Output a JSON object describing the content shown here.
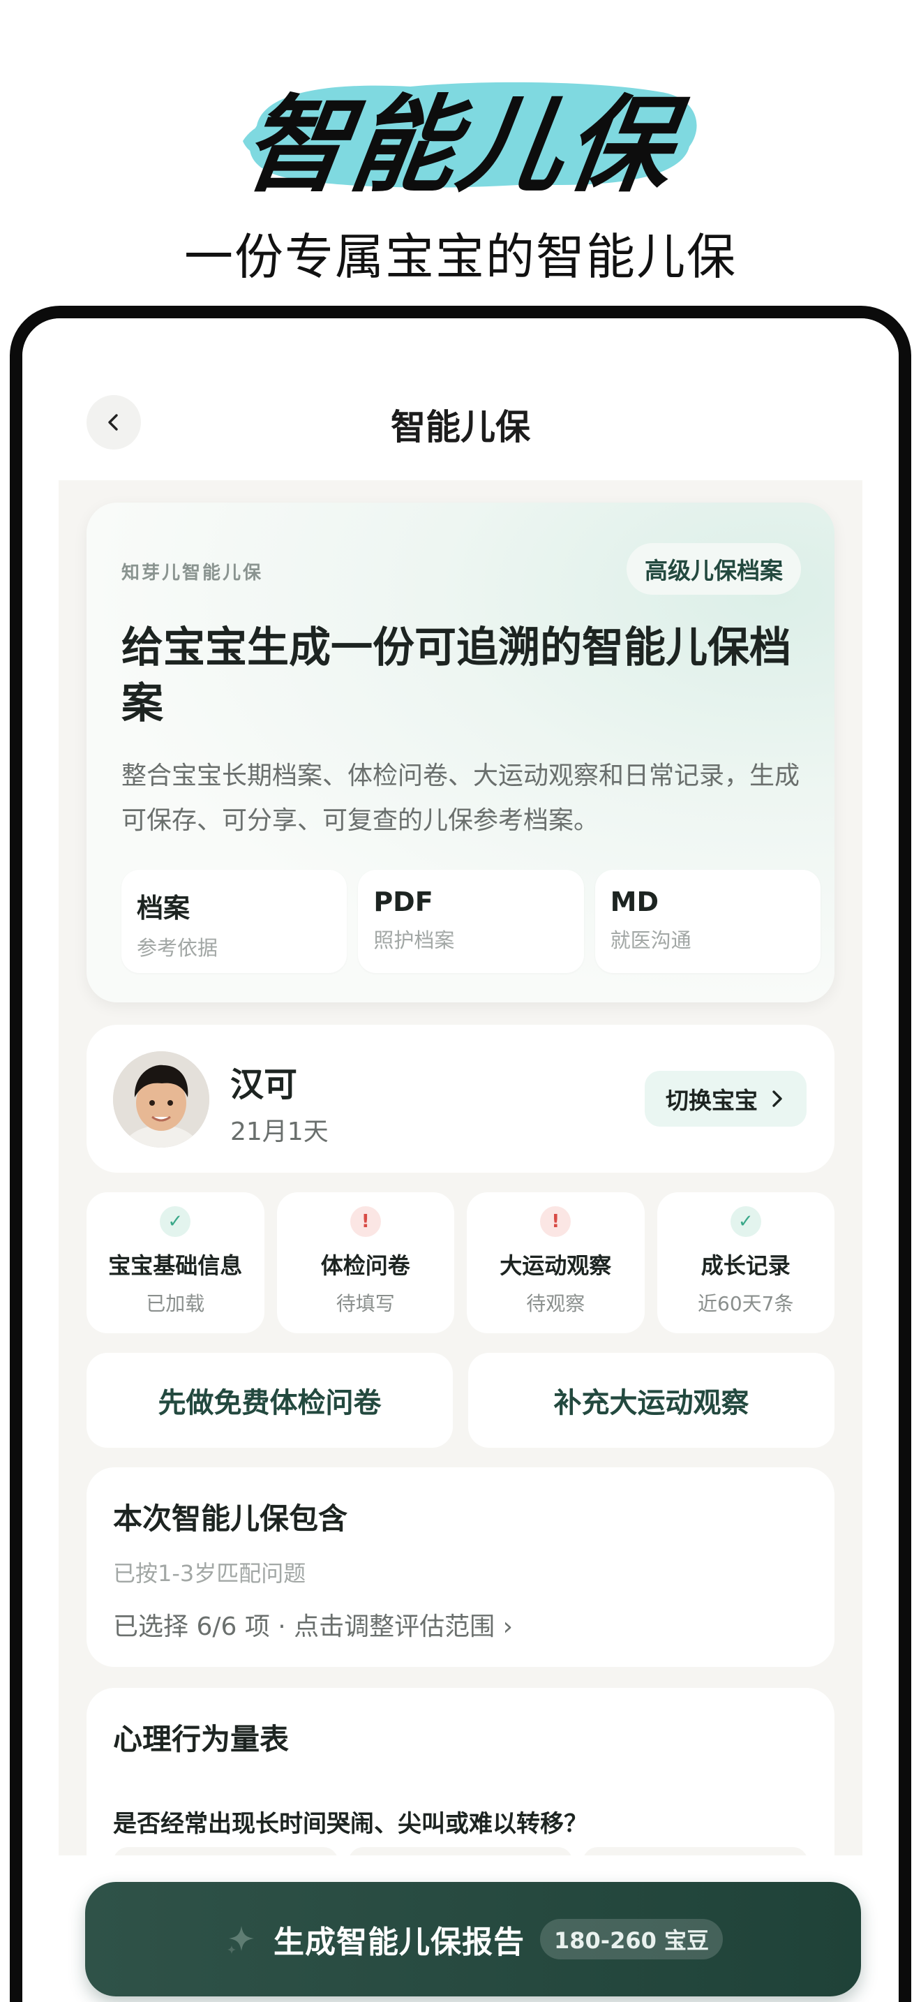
{
  "promo": {
    "title": "智能儿保",
    "subtitle": "一份专属宝宝的智能儿保",
    "brush_color": "#7fd9e0"
  },
  "nav": {
    "back_icon": "chevron-left-icon",
    "title": "智能儿保"
  },
  "hero": {
    "brand": "知芽儿智能儿保",
    "badge": "高级儿保档案",
    "title": "给宝宝生成一份可追溯的智能儿保档案",
    "description": "整合宝宝长期档案、体检问卷、大运动观察和日常记录，生成可保存、可分享、可复查的儿保参考档案。",
    "tiles": [
      {
        "head": "档案",
        "sub": "参考依据"
      },
      {
        "head": "PDF",
        "sub": "照护档案"
      },
      {
        "head": "MD",
        "sub": "就医沟通"
      }
    ]
  },
  "baby": {
    "name": "汉可",
    "age": "21月1天",
    "switch_label": "切换宝宝",
    "switch_icon": "chevron-right-icon"
  },
  "status": [
    {
      "icon": "check-icon",
      "state": "ok",
      "glyph": "✓",
      "label": "宝宝基础信息",
      "sub": "已加载"
    },
    {
      "icon": "alert-icon",
      "state": "warn",
      "glyph": "!",
      "label": "体检问卷",
      "sub": "待填写"
    },
    {
      "icon": "alert-icon",
      "state": "warn",
      "glyph": "!",
      "label": "大运动观察",
      "sub": "待观察"
    },
    {
      "icon": "check-icon",
      "state": "ok",
      "glyph": "✓",
      "label": "成长记录",
      "sub": "近60天7条"
    }
  ],
  "actions": {
    "questionnaire": "先做免费体检问卷",
    "motor": "补充大运动观察"
  },
  "includes": {
    "title": "本次智能儿保包含",
    "age_match": "已按1-3岁匹配问题",
    "selection": "已选择 6/6 项 · 点击调整评估范围 ›"
  },
  "scale": {
    "title": "心理行为量表",
    "question": "是否经常出现长时间哭闹、尖叫或难以转移？"
  },
  "generate": {
    "icon": "sparkle-icon",
    "label": "生成智能儿保报告",
    "price": "180-260 宝豆"
  },
  "colors": {
    "accent": "#23493f",
    "button_dark": "#284b41",
    "ok": "#3aa889",
    "warn": "#d84b45"
  }
}
